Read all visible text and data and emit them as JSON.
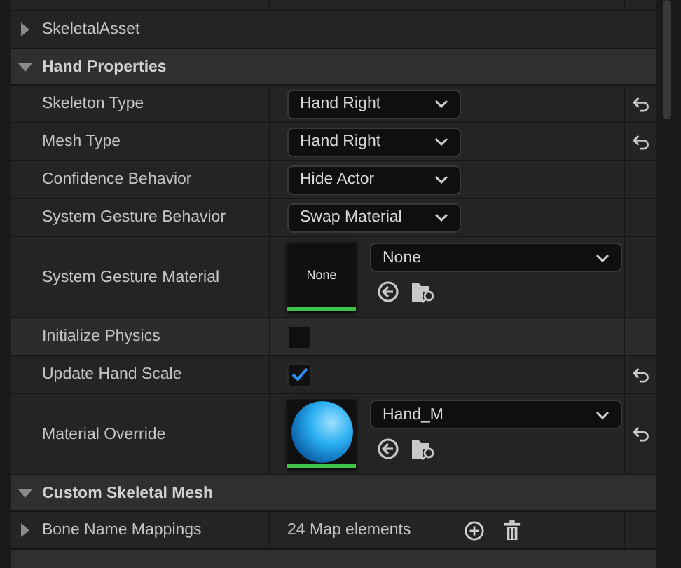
{
  "rows": [
    {
      "kind": "group",
      "label": "SkeletalAsset",
      "expanded": false
    },
    {
      "kind": "category",
      "label": "Hand Properties",
      "expanded": true
    },
    {
      "kind": "enum",
      "label": "Skeleton Type",
      "value": "Hand Right",
      "reset": true
    },
    {
      "kind": "enum",
      "label": "Mesh Type",
      "value": "Hand Right",
      "reset": true
    },
    {
      "kind": "enum",
      "label": "Confidence Behavior",
      "value": "Hide Actor",
      "reset": false
    },
    {
      "kind": "enum",
      "label": "System Gesture Behavior",
      "value": "Swap Material",
      "reset": false
    },
    {
      "kind": "asset",
      "label": "System Gesture Material",
      "preview": {
        "kind": "label",
        "text": "None"
      },
      "value": "None",
      "reset": false
    },
    {
      "kind": "checkbox",
      "label": "Initialize Physics",
      "checked": false,
      "reset": false
    },
    {
      "kind": "checkbox",
      "label": "Update Hand Scale",
      "checked": true,
      "reset": true
    },
    {
      "kind": "asset",
      "label": "Material Override",
      "preview": {
        "kind": "sphere"
      },
      "value": "Hand_M",
      "reset": true
    },
    {
      "kind": "category",
      "label": "Custom Skeletal Mesh",
      "expanded": true
    },
    {
      "kind": "map",
      "label": "Bone Name Mappings",
      "expanded": false,
      "value": "24 Map elements",
      "reset": false
    }
  ]
}
